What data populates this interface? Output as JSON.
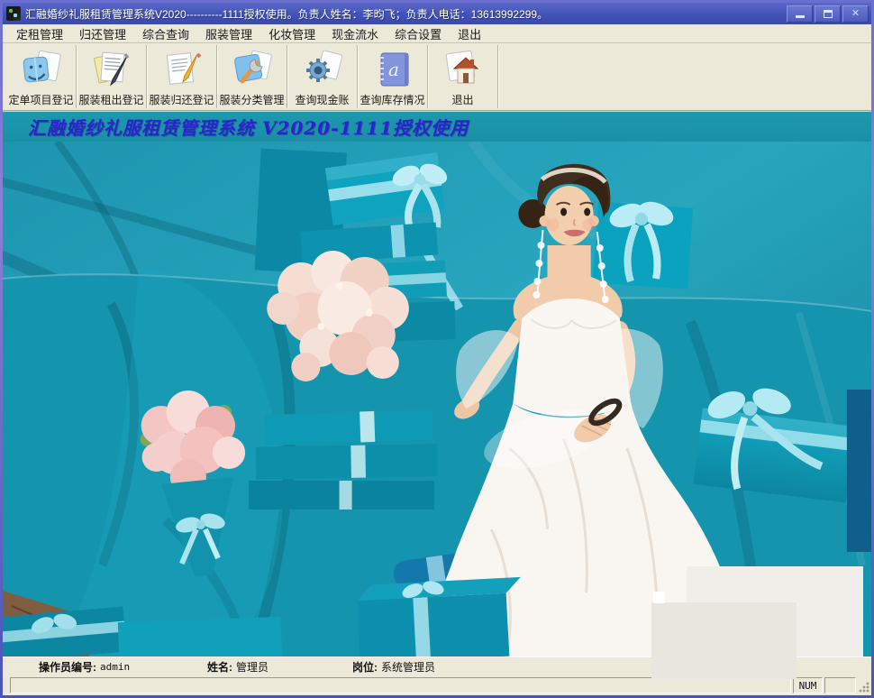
{
  "window": {
    "title": "汇融婚纱礼服租赁管理系统V2020----------1111授权使用。负责人姓名：李昀飞；负责人电话：13613992299。",
    "close_glyph": "✕"
  },
  "menu": {
    "items": [
      "定租管理",
      "归还管理",
      "综合查询",
      "服装管理",
      "化妆管理",
      "现金流水",
      "综合设置",
      "退出"
    ]
  },
  "toolbar": {
    "buttons": [
      {
        "label": "定单项目登记",
        "icon": "order-folder-icon"
      },
      {
        "label": "服装租出登记",
        "icon": "rent-out-doc-pen-icon"
      },
      {
        "label": "服装归还登记",
        "icon": "return-doc-pencil-icon"
      },
      {
        "label": "服装分类管理",
        "icon": "wrench-box-icon"
      },
      {
        "label": "查询现金账",
        "icon": "gear-doc-icon"
      },
      {
        "label": "查询库存情况",
        "icon": "notebook-a-icon"
      },
      {
        "label": "退出",
        "icon": "exit-home-icon"
      }
    ]
  },
  "banner": {
    "text": "汇融婚纱礼服租赁管理系统 V2020-1111授权使用",
    "text_color": "#2c22cf",
    "background": "#1a90a5"
  },
  "statusbar": {
    "operator_label": "操作员编号:",
    "operator_value": "admin",
    "name_label": "姓名:",
    "name_value": "管理员",
    "position_label": "岗位:",
    "position_value": "系统管理员",
    "num_indicator": "NUM"
  },
  "colors": {
    "titlebar": "#4252b6",
    "photo_teal": "#1b9cb4",
    "chrome_gray": "#ece9d8"
  }
}
